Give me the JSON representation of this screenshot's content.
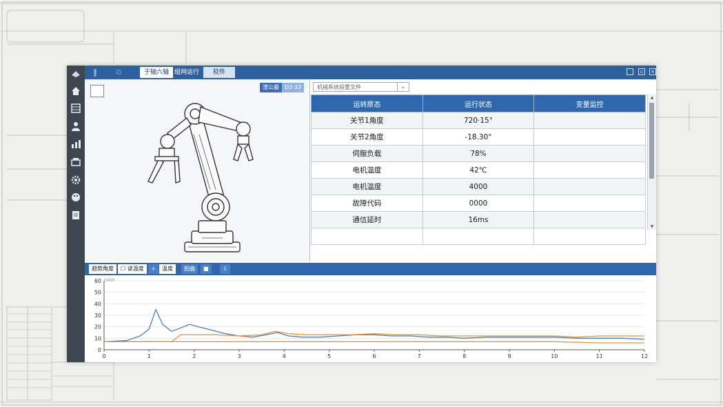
{
  "topbar": {
    "tabs": [
      {
        "label": "于轴六轴",
        "active": true
      },
      {
        "label": "组网运行",
        "active": false
      },
      {
        "label": "软件",
        "active": false
      }
    ]
  },
  "left_panel": {
    "buttons": [
      "渲公最",
      "D3·33"
    ]
  },
  "right_panel": {
    "dropdown_value": "机械系统段置文件",
    "table": {
      "headers": [
        "运转原态",
        "运行状态",
        "变量监控"
      ],
      "rows": [
        [
          "关节1角度",
          "720·15°",
          ""
        ],
        [
          "关节2角度",
          "-18.30°",
          ""
        ],
        [
          "伺服负载",
          "78%",
          ""
        ],
        [
          "电机温度",
          "42℃",
          ""
        ],
        [
          "电机温度",
          "4000",
          ""
        ],
        [
          "故障代码",
          "0000",
          ""
        ],
        [
          "通信延时",
          "16ms",
          ""
        ],
        [
          "",
          "",
          ""
        ]
      ]
    }
  },
  "chart_toolbar": {
    "items": [
      "趋势角度",
      "读温度",
      "温度",
      "拍曲"
    ]
  },
  "colors": {
    "topbar": "#2e5f9e",
    "table_header": "#2f67ae",
    "series_blue": "#4a7fb0",
    "series_orange": "#e8943a"
  },
  "chart_data": {
    "type": "line",
    "xlim": [
      0,
      12
    ],
    "ylim": [
      0,
      60
    ],
    "xticks": [
      "0",
      "1",
      "2",
      "3",
      "4",
      "5",
      "6",
      "7",
      "8",
      "9",
      "10",
      "11",
      "12"
    ],
    "yticks": [
      "0",
      "10",
      "20",
      "30",
      "40",
      "50",
      "60"
    ],
    "series": [
      {
        "color": "#4a7fb0",
        "x": [
          0,
          0.5,
          0.8,
          1.0,
          1.15,
          1.3,
          1.5,
          1.7,
          1.9,
          2.1,
          2.4,
          2.7,
          3.0,
          3.3,
          3.6,
          3.85,
          4.1,
          4.4,
          4.8,
          5.2,
          5.6,
          6.0,
          6.4,
          6.8,
          7.2,
          7.6,
          8.0,
          8.5,
          9.0,
          9.5,
          10.0,
          10.5,
          11.0,
          11.5,
          12.0
        ],
        "y": [
          7,
          8,
          12,
          18,
          35,
          22,
          16,
          19,
          22,
          20,
          17,
          14,
          12,
          11,
          13,
          15,
          12,
          11,
          11,
          12,
          13,
          13,
          12,
          12,
          11,
          11,
          10,
          11,
          11,
          11,
          11,
          10,
          10,
          10,
          9
        ]
      },
      {
        "color": "#e8943a",
        "x": [
          0,
          0.5,
          1.0,
          1.5,
          1.7,
          2.0,
          2.5,
          3.0,
          3.5,
          3.8,
          4.1,
          4.5,
          5.0,
          5.5,
          6.0,
          6.5,
          7.0,
          7.5,
          8.0,
          8.5,
          9.0,
          9.5,
          10.0,
          10.5,
          11.0,
          11.5,
          12.0
        ],
        "y": [
          7,
          7,
          7,
          7,
          13,
          13,
          13,
          12,
          13,
          16,
          14,
          13,
          13,
          13,
          14,
          13,
          13,
          12,
          12,
          12,
          12,
          12,
          12,
          11,
          12,
          12,
          12
        ]
      },
      {
        "color": "#e8943a",
        "x": [
          0,
          1.0,
          2.0,
          3.0,
          4.0,
          5.0,
          6.0,
          7.0,
          8.0,
          9.0,
          10.0,
          11.0,
          12.0
        ],
        "y": [
          7,
          7,
          7,
          7,
          7,
          7,
          7,
          7,
          7,
          7,
          7,
          6,
          6
        ]
      }
    ],
    "annotation": "Y400"
  }
}
